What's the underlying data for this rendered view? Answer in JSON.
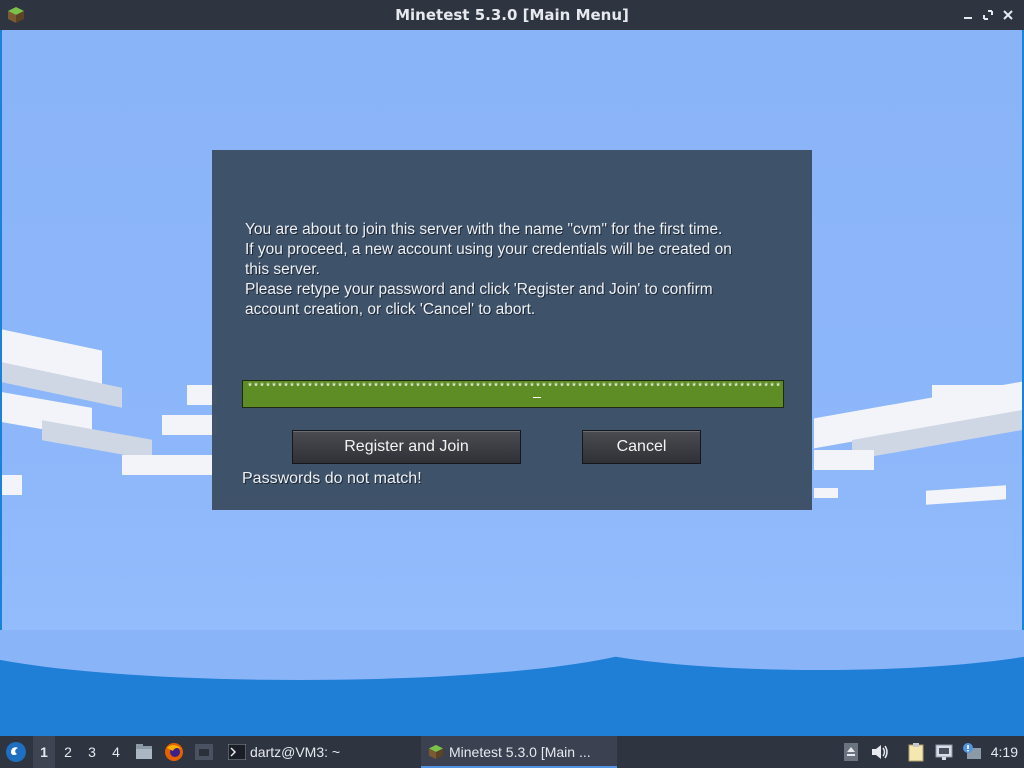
{
  "window": {
    "title": "Minetest 5.3.0 [Main Menu]"
  },
  "dialog": {
    "message_lines": [
      "You are about to join this server with the name \"cvm\" for the first time.",
      "If you proceed, a new account using your credentials will be created on",
      "this server.",
      "Please retype your password and click 'Register and Join' to confirm",
      "account creation, or click 'Cancel' to abort."
    ],
    "password_value": "*****************************************************************************************",
    "register_label": "Register and Join",
    "cancel_label": "Cancel",
    "error_text": "Passwords do not match!"
  },
  "taskbar": {
    "workspaces": [
      "1",
      "2",
      "3",
      "4"
    ],
    "active_workspace": "1",
    "tasks": [
      {
        "label": "dartz@VM3: ~",
        "icon": "terminal-icon"
      },
      {
        "label": "Minetest 5.3.0 [Main ...",
        "icon": "minetest-icon"
      }
    ],
    "clock": "4:19"
  },
  "colors": {
    "dialog_bg": "#3c4e64",
    "field_bg": "#5e8c25",
    "taskbar_bg": "#2e3440",
    "sky": "#8ab4f8",
    "water": "#1f7fd6"
  }
}
